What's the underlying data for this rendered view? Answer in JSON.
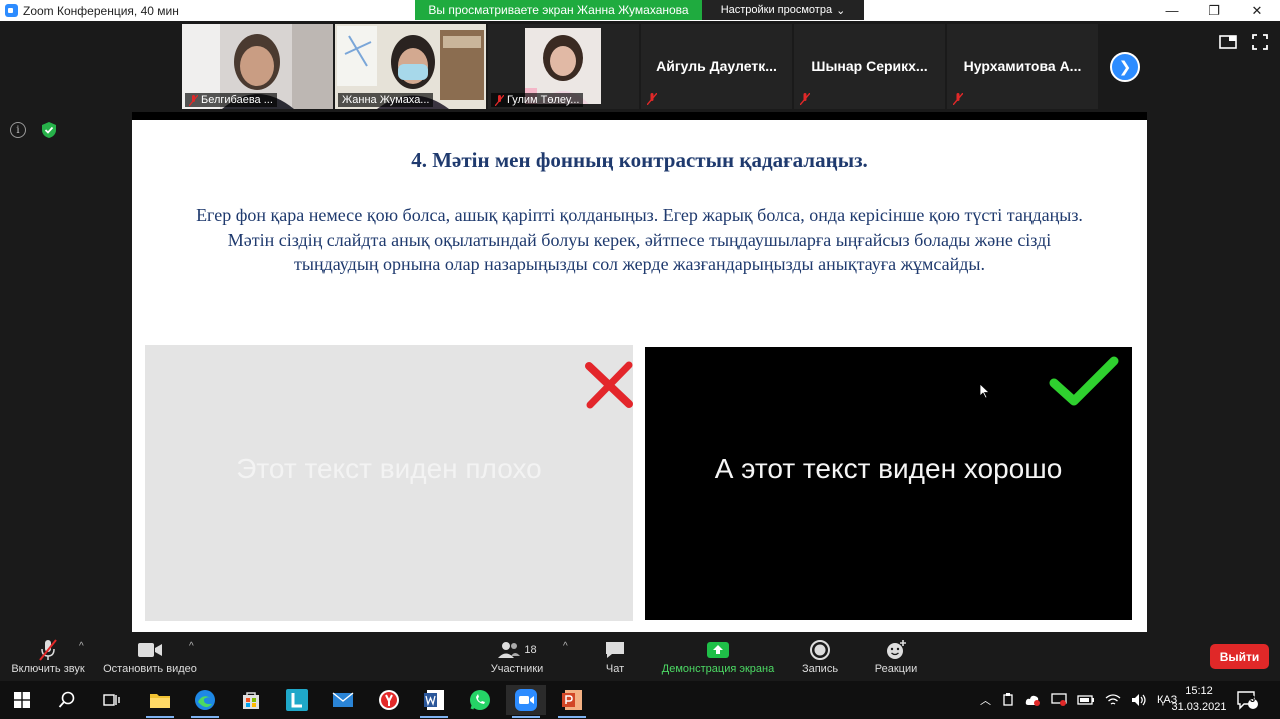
{
  "window": {
    "title": "Zoom Конференция, 40 мин",
    "minimize": "—",
    "restore": "❐",
    "close": "✕"
  },
  "share_banner": {
    "text": "Вы просматриваете экран Жанна Жумаханова",
    "view_options": "Настройки просмотра"
  },
  "participants": [
    {
      "name": "Белгибаева ...",
      "muted": true,
      "has_video": true
    },
    {
      "name": "Жанна Жумаха...",
      "muted": false,
      "has_video": true,
      "active": true
    },
    {
      "name": "Гулим Төлеу...",
      "muted": true,
      "has_video": true
    },
    {
      "name": "Айгуль  Даулетк...",
      "muted": true,
      "has_video": false
    },
    {
      "name": "Шынар  Серикх...",
      "muted": true,
      "has_video": false
    },
    {
      "name": "Нурхамитова  А...",
      "muted": true,
      "has_video": false
    }
  ],
  "slide": {
    "heading": "4. Мәтін мен фонның контрастын қадағалаңыз.",
    "paragraph": "Егер фон қара немесе қою болса, ашық қаріпті қолданыңыз. Егер жарық болса, онда керісінше қою түсті таңдаңыз. Мәтін сіздің слайдта анық оқылатындай болуы керек, әйтпесе тыңдаушыларға ыңғайсыз болады және сізді тыңдаудың орнына олар назарыңызды сол жерде жазғандарыңызды анықтауға жұмсайды.",
    "bad_example": "Этот текст виден плохо",
    "good_example": "А этот текст виден хорошо",
    "colors": {
      "heading": "#1f3a6e",
      "bad_bg": "#e4e4e4",
      "good_bg": "#000000",
      "cross": "#e3262b",
      "check": "#2fd02f"
    }
  },
  "toolbar": {
    "unmute": "Включить звук",
    "stop_video": "Остановить видео",
    "participants": "Участники",
    "participants_count": "18",
    "chat": "Чат",
    "share_screen": "Демонстрация экрана",
    "record": "Запись",
    "reactions": "Реакции",
    "leave": "Выйти"
  },
  "taskbar": {
    "language": "ҚАЗ",
    "time": "15:12",
    "date": "31.03.2021",
    "notifications": "3"
  }
}
